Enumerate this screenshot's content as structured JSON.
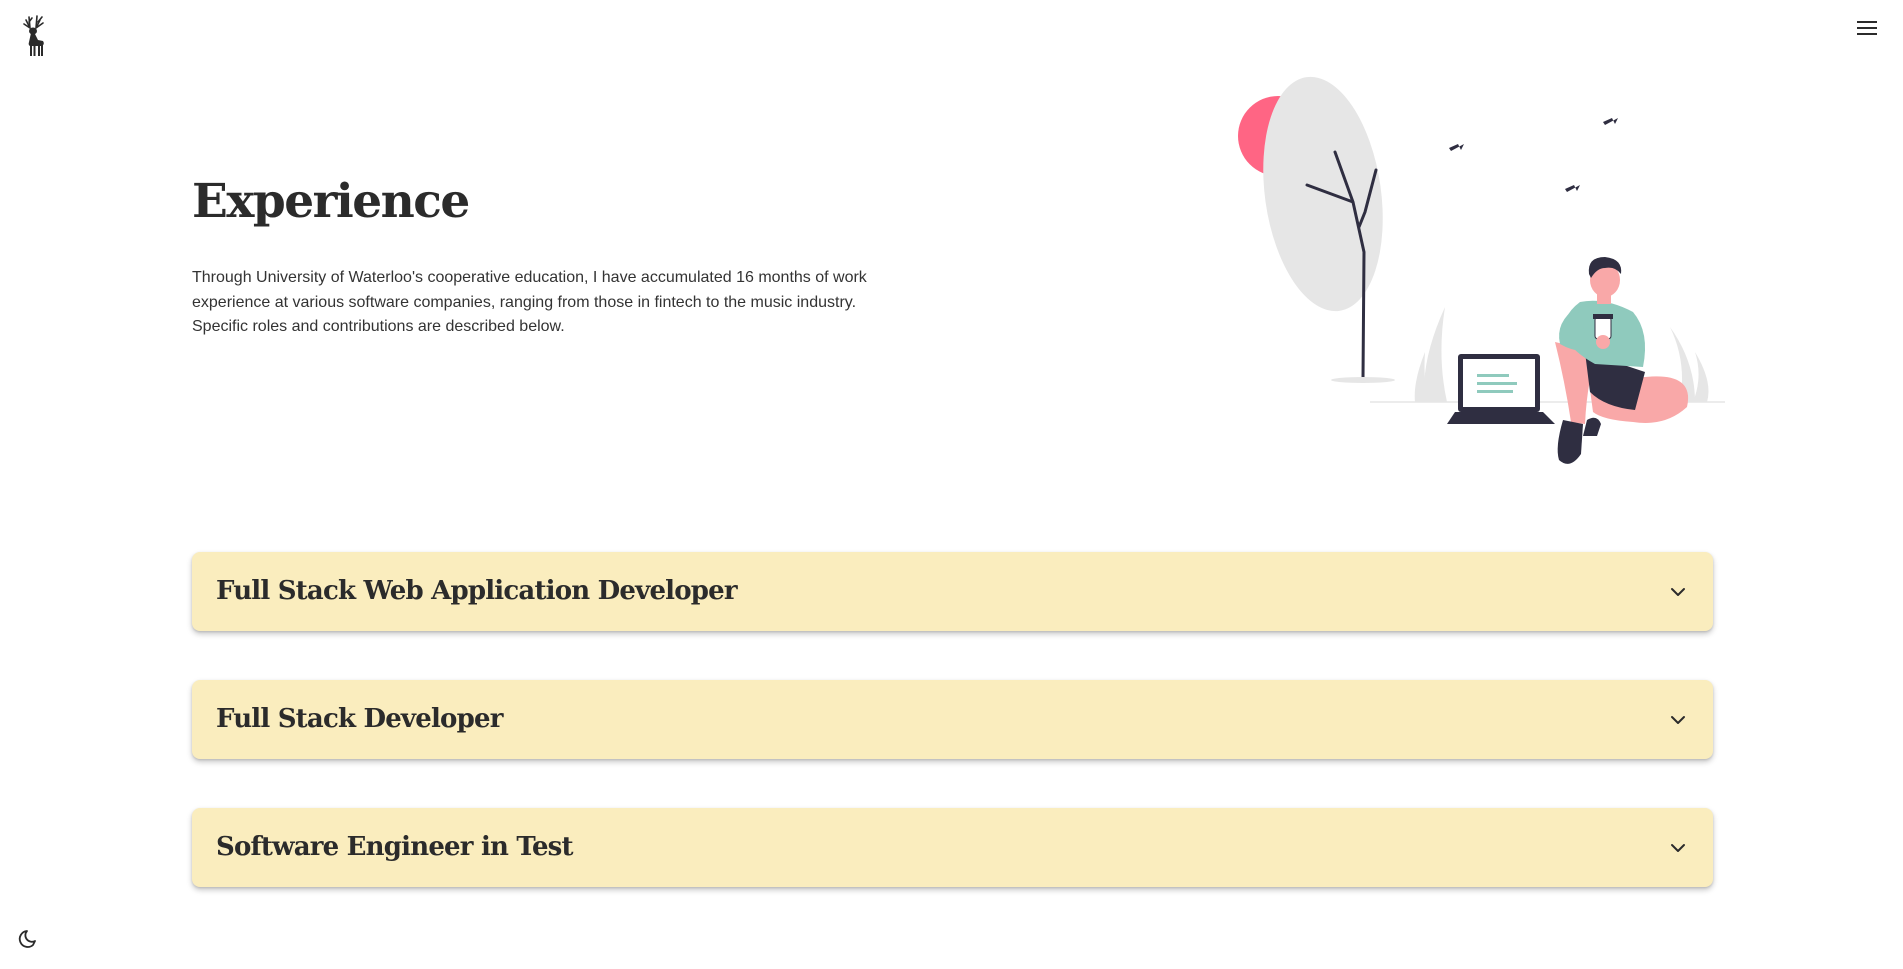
{
  "header": {
    "logo_icon": "deer-icon",
    "menu_icon": "hamburger-menu-icon"
  },
  "hero": {
    "title": "Experience",
    "description": "Through University of Waterloo's cooperative education, I have accumulated 16 months of work experience at various software companies, ranging from those in fintech to the music industry. Specific roles and contributions are described below.",
    "illustration": "person-with-laptop-illustration"
  },
  "experience": {
    "items": [
      {
        "title": "Full Stack Web Application Developer",
        "expanded": false
      },
      {
        "title": "Full Stack Developer",
        "expanded": false
      },
      {
        "title": "Software Engineer in Test",
        "expanded": false
      }
    ],
    "expand_icon": "chevron-down-icon"
  },
  "footer": {
    "theme_toggle_icon": "moon-icon"
  },
  "colors": {
    "accordion_bg": "#faedbe",
    "text": "#2b2b2b",
    "accent_teal": "#8fcabd",
    "accent_pink": "#ff6584",
    "dark_navy": "#2f2e41"
  }
}
